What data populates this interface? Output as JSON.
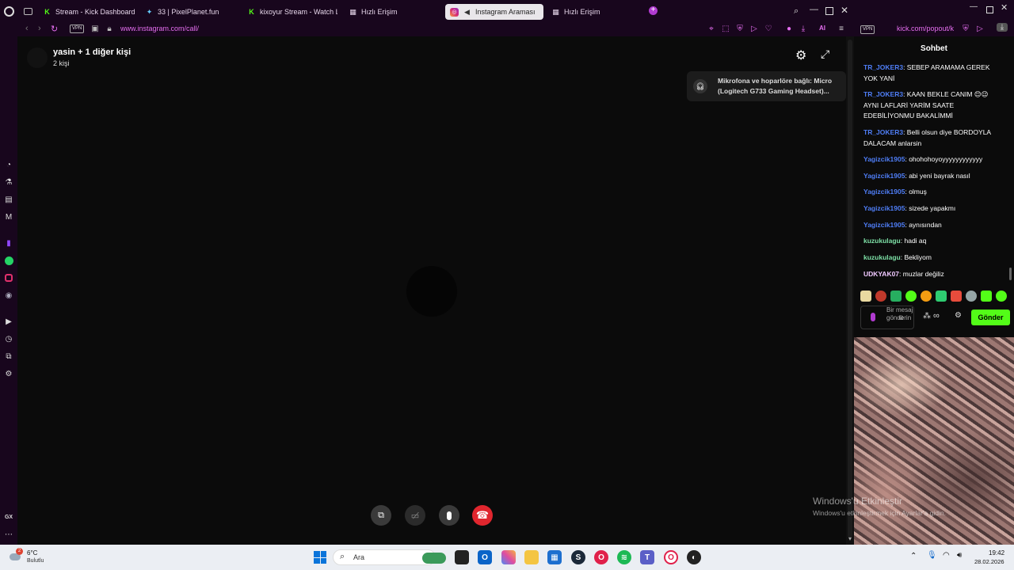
{
  "tabs": [
    {
      "label": "Stream - Kick Dashboard",
      "icon": "kick-icon"
    },
    {
      "label": "33 | PixelPlanet.fun",
      "icon": "pixelplanet-icon"
    },
    {
      "label": "kixoyur Stream - Watch Li",
      "icon": "kick-icon"
    },
    {
      "label": "Hızlı Erişim",
      "icon": "grid-icon"
    },
    {
      "label": "Instagram Araması",
      "icon": "instagram-icon",
      "active": true
    },
    {
      "label": "Hızlı Erişim",
      "icon": "grid-icon"
    }
  ],
  "address": {
    "vpn": "VPN",
    "url": "www.instagram.com/call/",
    "popout_url": "kick.com/popout/k",
    "ai_label": "AI"
  },
  "call": {
    "title": "yasin + 1 diğer kişi",
    "subtitle": "2 kişi",
    "notice_line1": "Mikrofona ve hoparlöre bağlı: Micro",
    "notice_line2": "(Logitech G733 Gaming Headset)..."
  },
  "chat": {
    "title": "Sohbet",
    "messages": [
      {
        "user": "TR_JOKER3",
        "color": "#4f7ef7",
        "text": ": SEBEP ARAMAMA GEREK YOK YANİ"
      },
      {
        "user": "TR_JOKER3",
        "color": "#4f7ef7",
        "text": ": KAAN BEKLE CANIM 😊😉 AYNI LAFLARİ YARİM SAATE EDEBİLİYONMU BAKALİMMİ"
      },
      {
        "user": "TR_JOKER3",
        "color": "#4f7ef7",
        "text": ": Belli olsun diye BORDOYLA DALACAM anlarsin"
      },
      {
        "user": "Yagizcik1905",
        "color": "#4f7ef7",
        "text": ": ohohohoyoyyyyyyyyyyyy"
      },
      {
        "user": "Yagizcik1905",
        "color": "#4f7ef7",
        "text": ": abi yeni bayrak nasıl"
      },
      {
        "user": "Yagizcik1905",
        "color": "#4f7ef7",
        "text": ": olmuş"
      },
      {
        "user": "Yagizcik1905",
        "color": "#4f7ef7",
        "text": ": sizede yapakmı"
      },
      {
        "user": "Yagizcik1905",
        "color": "#4f7ef7",
        "text": ": aynısından"
      },
      {
        "user": "kuzukulagu",
        "color": "#7de0a6",
        "text": ": hadi aq"
      },
      {
        "user": "kuzukulagu",
        "color": "#7de0a6",
        "text": ": Bekliyom"
      },
      {
        "user": "UDKYAK07",
        "color": "#f0c8ff",
        "text": ": muzlar değiliz"
      }
    ],
    "input_placeholder": "Bir mesaj gönderin",
    "send_label": "Gönder"
  },
  "watermark": {
    "line1": "Windows'u Etkinleştir",
    "line2": "Windows'u etkinleştirmek için Ayarlar'a gidin."
  },
  "taskbar": {
    "weather_temp": "6°C",
    "weather_desc": "Bulutlu",
    "weather_badge": "2",
    "search_label": "Ara",
    "time": "19:42",
    "date": "28.02.2026"
  },
  "colors": {
    "accent": "#e56ef0",
    "kick_green": "#53fc18",
    "end_call": "#e0262e",
    "browser_bg": "#18061d"
  }
}
